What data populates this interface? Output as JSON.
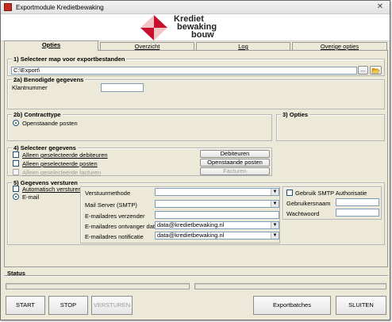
{
  "window": {
    "title": "Exportmodule Kredietbewaking",
    "close_glyph": "✕"
  },
  "logo": {
    "line1": "Krediet",
    "line2": "bewaking",
    "line3": "bouw"
  },
  "tabs": [
    {
      "label": "Opties",
      "active": true
    },
    {
      "label": "Overzicht",
      "active": false
    },
    {
      "label": "Log",
      "active": false
    },
    {
      "label": "Overige opties",
      "active": false
    }
  ],
  "section1": {
    "title": "1) Selecteer map voor exportbestanden",
    "path_value": "C:\\Export\\",
    "browse_label": "...",
    "folder_icon": "folder-open-icon"
  },
  "section2a": {
    "title": "2a) Benodigde gegevens",
    "klantnummer_label": "Klantnummer",
    "klantnummer_value": ""
  },
  "section2b": {
    "title": "2b) Contracttype",
    "radio_label": "Openstaande posten"
  },
  "section3": {
    "title": "3) Opties"
  },
  "section4": {
    "title": "4) Selecteer gegevens",
    "checks": [
      {
        "label": "Alleen geselecteerde debiteuren",
        "disabled": false
      },
      {
        "label": "Alleen geselecteerde posten",
        "disabled": false
      },
      {
        "label": "Alleen geselecteerde facturen",
        "disabled": true
      }
    ],
    "buttons": [
      {
        "label": "Debiteuren",
        "disabled": false
      },
      {
        "label": "Openstaande posten",
        "disabled": false
      },
      {
        "label": "Facturen",
        "disabled": true
      }
    ]
  },
  "section5": {
    "title": "5) Gegevens versturen",
    "auto_send_label": "Automatisch versturen",
    "email_radio_label": "E-mail",
    "fields": {
      "method_label": "Verstuurmethode",
      "method_value": "",
      "smtp_label": "Mail Server (SMTP)",
      "smtp_value": "",
      "from_label": "E-mailadres verzender",
      "from_value": "",
      "to_label": "E-mailadres ontvanger data",
      "to_value": "data@kredietbewaking.nl",
      "notify_label": "E-mailadres notificatie",
      "notify_value": "data@kredietbewaking.nl"
    },
    "smtp_auth_label": "Gebruik SMTP Authorisatie",
    "username_label": "Gebruikersnaam",
    "username_value": "",
    "password_label": "Wachtwoord",
    "password_value": ""
  },
  "status": {
    "title": "Status",
    "left_text": "",
    "right_text": ""
  },
  "bottom": {
    "start_label": "START",
    "stop_label": "STOP",
    "send_label": "VERSTUREN",
    "exportbatches_label": "Exportbatches",
    "close_label": "SLUITEN"
  },
  "colors": {
    "logo_red": "#c8102e",
    "logo_pink": "#f1c5c5"
  }
}
